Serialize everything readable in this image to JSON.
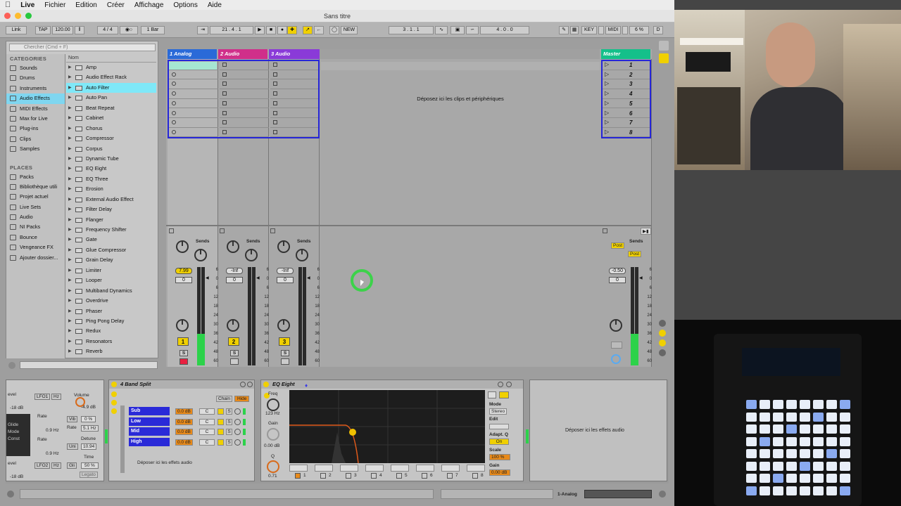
{
  "menubar": {
    "apple": "",
    "items": [
      "Live",
      "Fichier",
      "Edition",
      "Créer",
      "Affichage",
      "Options",
      "Aide"
    ]
  },
  "window": {
    "title": "Sans titre"
  },
  "transport": {
    "link": "Link",
    "tap": "TAP",
    "tempo": "120.00",
    "signature": "4 / 4",
    "quantize": "1 Bar",
    "position": "21 .  4 .  1",
    "new": "NEW",
    "loop_start": "3 .  1 .  1",
    "loop_length": "4 .  0 .  0",
    "key": "KEY",
    "midi": "MIDI",
    "cpu": "6 %",
    "d": "D"
  },
  "browser": {
    "search_placeholder": "Chercher (Cmd + F)",
    "categories_title": "CATEGORIES",
    "categories": [
      "Sounds",
      "Drums",
      "Instruments",
      "Audio Effects",
      "MIDI Effects",
      "Max for Live",
      "Plug-ins",
      "Clips",
      "Samples"
    ],
    "places_title": "PLACES",
    "places": [
      "Packs",
      "Bibliothèque utili",
      "Projet actuel",
      "Live Sets",
      "Audio",
      "NI Packs",
      "Bounce",
      "Vengeance FX",
      "Ajouter dossier..."
    ],
    "list_header": "Nom",
    "items": [
      "Amp",
      "Audio Effect Rack",
      "Auto Filter",
      "Auto Pan",
      "Beat Repeat",
      "Cabinet",
      "Chorus",
      "Compressor",
      "Corpus",
      "Dynamic Tube",
      "EQ Eight",
      "EQ Three",
      "Erosion",
      "External Audio Effect",
      "Filter Delay",
      "Flanger",
      "Frequency Shifter",
      "Gate",
      "Glue Compressor",
      "Grain Delay",
      "Limiter",
      "Looper",
      "Multiband Dynamics",
      "Overdrive",
      "Phaser",
      "Ping Pong Delay",
      "Redux",
      "Resonators",
      "Reverb"
    ]
  },
  "session": {
    "tracks": [
      {
        "name": "1 Analog",
        "color": "#2a6ad8",
        "volume": "7.99",
        "pan": "0",
        "num": "1"
      },
      {
        "name": "2 Audio",
        "color": "#d02f8a",
        "volume": "-Inf",
        "pan": "0",
        "num": "2"
      },
      {
        "name": "3 Audio",
        "color": "#8a3ad8",
        "volume": "-Inf",
        "pan": "0",
        "num": "3"
      }
    ],
    "drop_text": "Déposez ici les clips et périphériques",
    "master": {
      "name": "Master",
      "color": "#14c08a",
      "volume": "-0.50",
      "pan": "0",
      "scenes": [
        "1",
        "2",
        "3",
        "4",
        "5",
        "6",
        "7",
        "8"
      ]
    },
    "sends_label": "Sends",
    "post": "Post",
    "solo": "S",
    "meter_scale": [
      "6",
      "0",
      "6",
      "12",
      "18",
      "24",
      "30",
      "36",
      "42",
      "48",
      "60"
    ]
  },
  "devices": {
    "left": {
      "level": "evel",
      "level_val": "-18 dB",
      "lfo1": "LFO1",
      "hz": "Hz",
      "volume_label": "Volume",
      "volume_val": "-4.9 dB",
      "rate": "Rate",
      "vib": "Vib",
      "vib_val": "0 %",
      "rate_val": "0.9 Hz",
      "rate2": "Rate",
      "rate2_val": "5.1 Hz",
      "detune": "Detune",
      "uni": "Uni",
      "uni_val": "10.94",
      "lfo2": "LFO2",
      "time": "Time",
      "gli": "Gli",
      "gli_val": "50 %",
      "legato": "Legato",
      "rate3": "Rate",
      "rate3_val": "0.9 Hz",
      "glide": "Glide",
      "mode": "Mode",
      "const": "Const"
    },
    "band_split": {
      "title": "4 Band Split",
      "chain": "Chain",
      "hide": "Hide",
      "bands": [
        {
          "name": "Sub",
          "db": "0.0 dB"
        },
        {
          "name": "Low",
          "db": "0.0 dB"
        },
        {
          "name": "Mid",
          "db": "0.0 dB"
        },
        {
          "name": "High",
          "db": "0.0 dB"
        }
      ],
      "drop": "Déposer ici les effets audio"
    },
    "eq": {
      "title": "EQ Eight",
      "freq": "Freq",
      "freq_val": "123 Hz",
      "gain": "Gain",
      "gain_val": "0.00 dB",
      "q": "Q",
      "q_val": "0.71",
      "mode": "Mode",
      "stereo": "Stereo",
      "edit": "Edit",
      "adapt": "Adapt. Q",
      "on": "On",
      "scale": "Scale",
      "scale_val": "100 %",
      "gain2": "Gain",
      "gain2_val": "0.00 dB",
      "bands": [
        "1",
        "2",
        "3",
        "4",
        "5",
        "6",
        "7",
        "8"
      ]
    },
    "drop_right": "Déposer ici les effets audio"
  },
  "status": {
    "track": "1-Analog"
  }
}
